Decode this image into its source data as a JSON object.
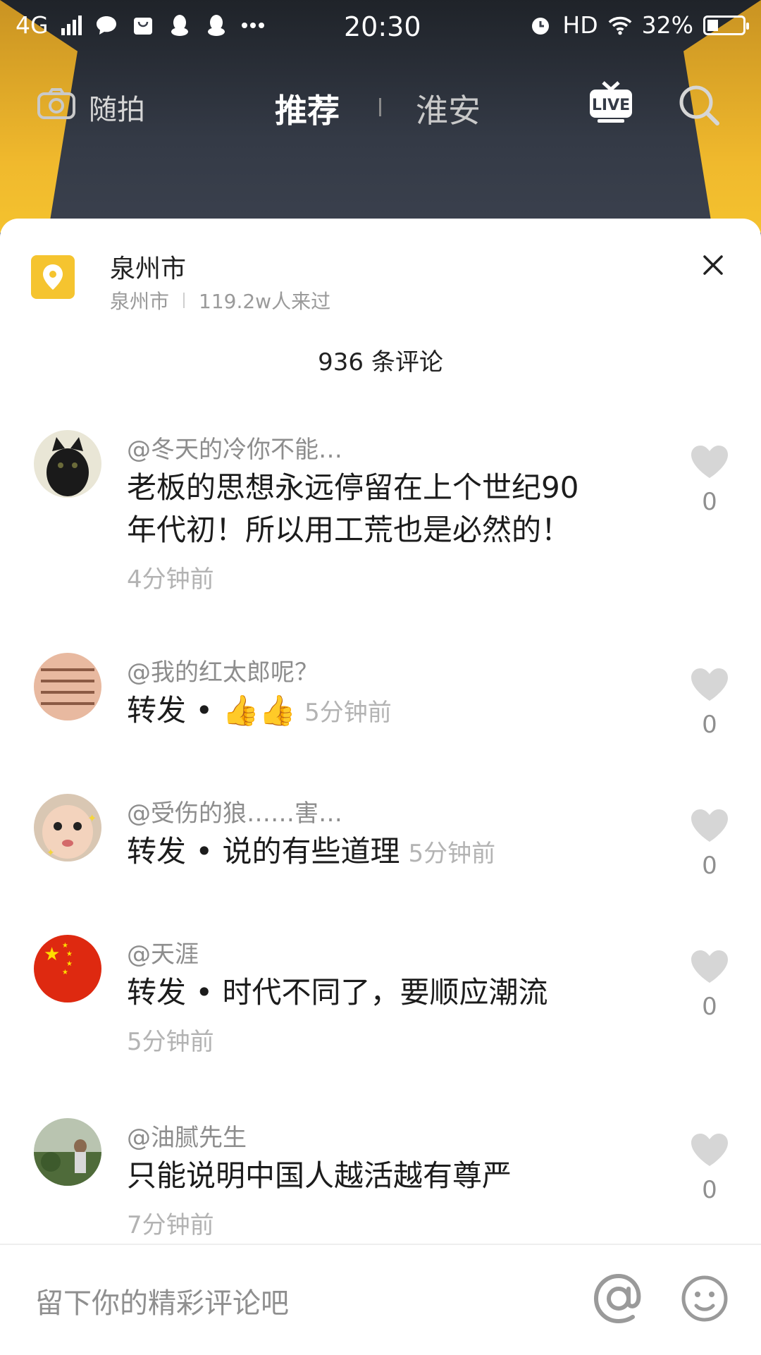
{
  "status_bar": {
    "network": "4G",
    "time": "20:30",
    "hd": "HD",
    "battery": "32%",
    "battery_level": 0.32
  },
  "nav": {
    "camera_label": "随拍",
    "tab_active": "推荐",
    "tab_other": "淮安"
  },
  "sheet": {
    "location_title": "泉州市",
    "location_sub_city": "泉州市",
    "location_sub_visits": "119.2w人来过",
    "comment_count": "936 条评论"
  },
  "comments": [
    {
      "user": "@冬天的冷你不能…",
      "text_line1": "老板的思想永远停留在上个世纪90",
      "text_line2": "年代初！所以用工荒也是必然的！",
      "time": "4分钟前",
      "likes": "0"
    },
    {
      "user": "@我的红太郎呢？",
      "text": "转发 • 👍👍",
      "time": "5分钟前",
      "likes": "0"
    },
    {
      "user": "@受伤的狼……害…",
      "text": "转发 • 说的有些道理",
      "time": "5分钟前",
      "likes": "0"
    },
    {
      "user": "@天涯",
      "text": "转发 • 时代不同了，要顺应潮流",
      "time": "5分钟前",
      "likes": "0"
    },
    {
      "user": "@油腻先生",
      "text": "只能说明中国人越活越有尊严",
      "time": "7分钟前",
      "likes": "0"
    }
  ],
  "input": {
    "placeholder": "留下你的精彩评论吧"
  },
  "colors": {
    "accent_yellow": "#f5c42f",
    "header_dark": "#343a46",
    "text_gray": "#8d8d8d",
    "heart_gray": "#d6d6d6"
  }
}
